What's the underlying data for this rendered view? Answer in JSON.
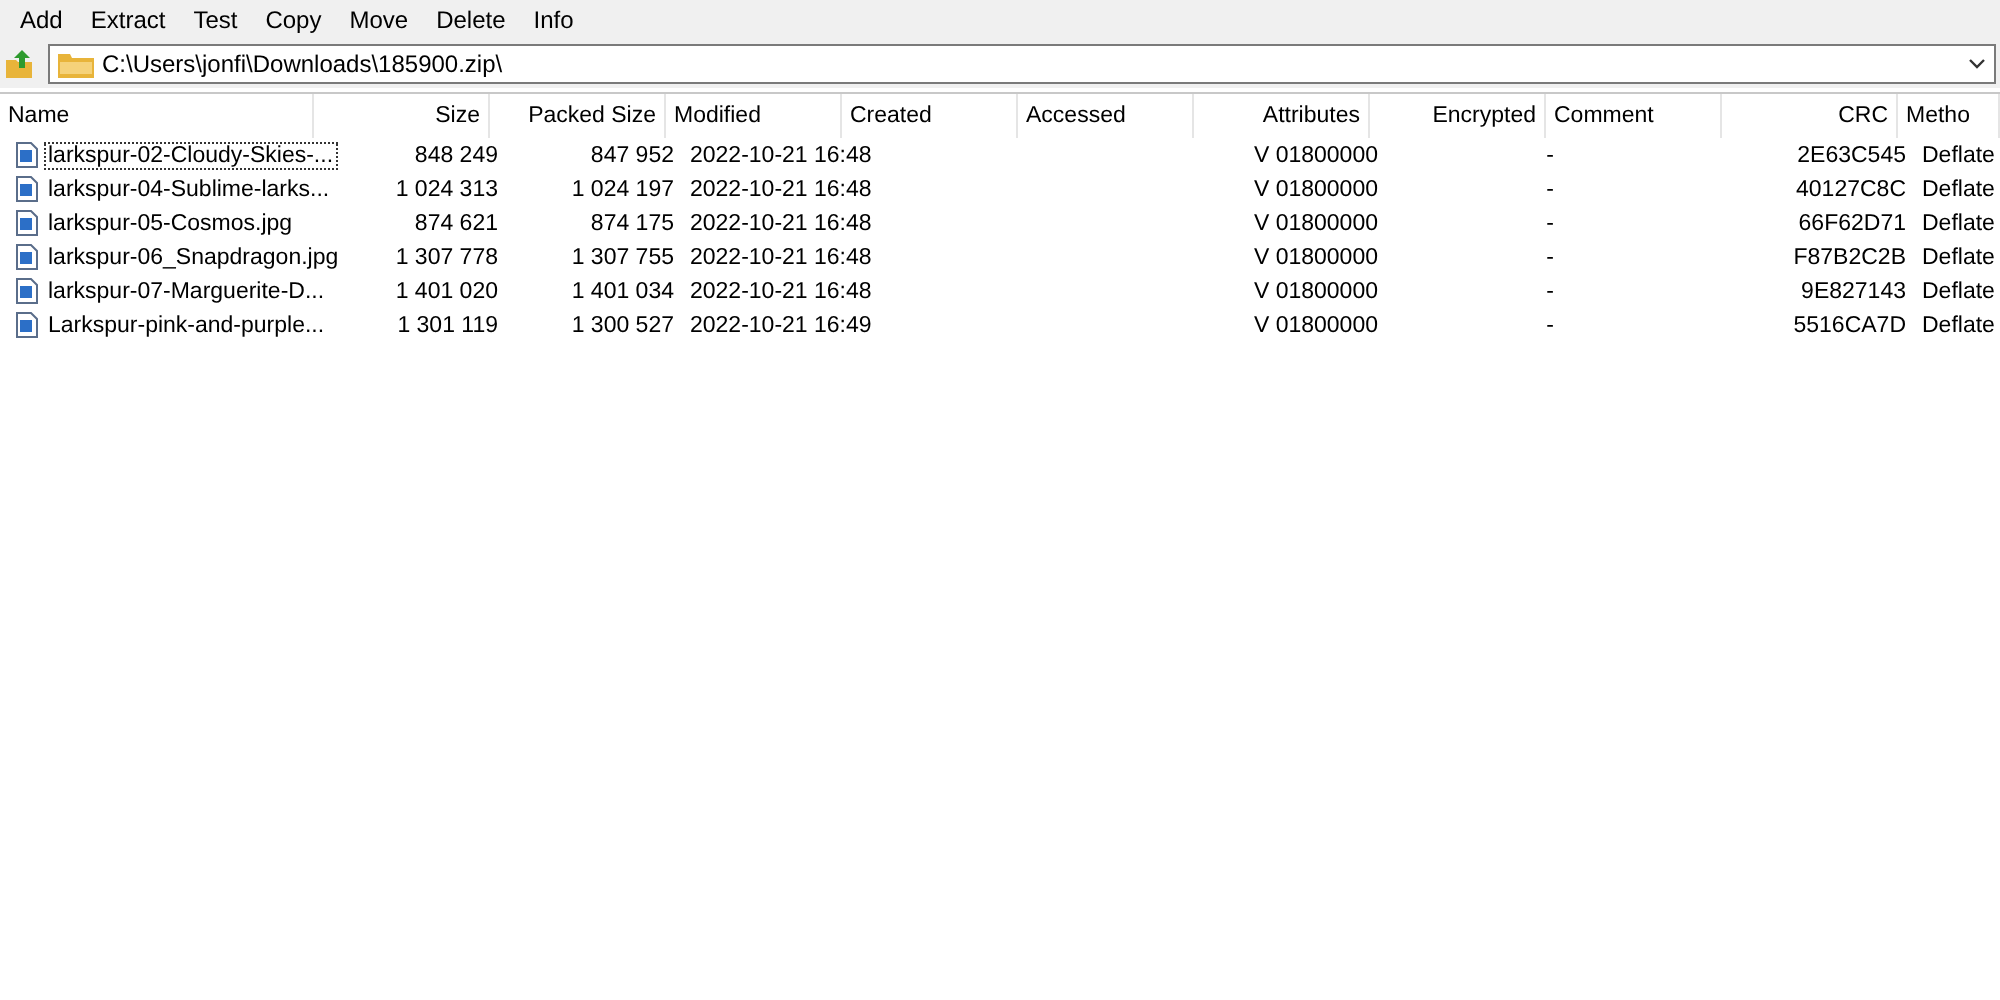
{
  "menu": [
    "Add",
    "Extract",
    "Test",
    "Copy",
    "Move",
    "Delete",
    "Info"
  ],
  "address": {
    "value": "C:\\Users\\jonfi\\Downloads\\185900.zip\\"
  },
  "table": {
    "columns": [
      "Name",
      "Size",
      "Packed Size",
      "Modified",
      "Created",
      "Accessed",
      "Attributes",
      "Encrypted",
      "Comment",
      "CRC",
      "Metho"
    ],
    "rows": [
      {
        "focused": true,
        "cells": [
          "larkspur-02-Cloudy-Skies-...",
          "848 249",
          "847 952",
          "2022-10-21 16:48",
          "",
          "",
          "V 01800000",
          "-",
          "",
          "2E63C545",
          "Deflate"
        ]
      },
      {
        "focused": false,
        "cells": [
          "larkspur-04-Sublime-larks...",
          "1 024 313",
          "1 024 197",
          "2022-10-21 16:48",
          "",
          "",
          "V 01800000",
          "-",
          "",
          "40127C8C",
          "Deflate"
        ]
      },
      {
        "focused": false,
        "cells": [
          "larkspur-05-Cosmos.jpg",
          "874 621",
          "874 175",
          "2022-10-21 16:48",
          "",
          "",
          "V 01800000",
          "-",
          "",
          "66F62D71",
          "Deflate"
        ]
      },
      {
        "focused": false,
        "cells": [
          "larkspur-06_Snapdragon.jpg",
          "1 307 778",
          "1 307 755",
          "2022-10-21 16:48",
          "",
          "",
          "V 01800000",
          "-",
          "",
          "F87B2C2B",
          "Deflate"
        ]
      },
      {
        "focused": false,
        "cells": [
          "larkspur-07-Marguerite-D...",
          "1 401 020",
          "1 401 034",
          "2022-10-21 16:48",
          "",
          "",
          "V 01800000",
          "-",
          "",
          "9E827143",
          "Deflate"
        ]
      },
      {
        "focused": false,
        "cells": [
          "Larkspur-pink-and-purple...",
          "1 301 119",
          "1 300 527",
          "2022-10-21 16:49",
          "",
          "",
          "V 01800000",
          "-",
          "",
          "5516CA7D",
          "Deflate"
        ]
      }
    ]
  }
}
